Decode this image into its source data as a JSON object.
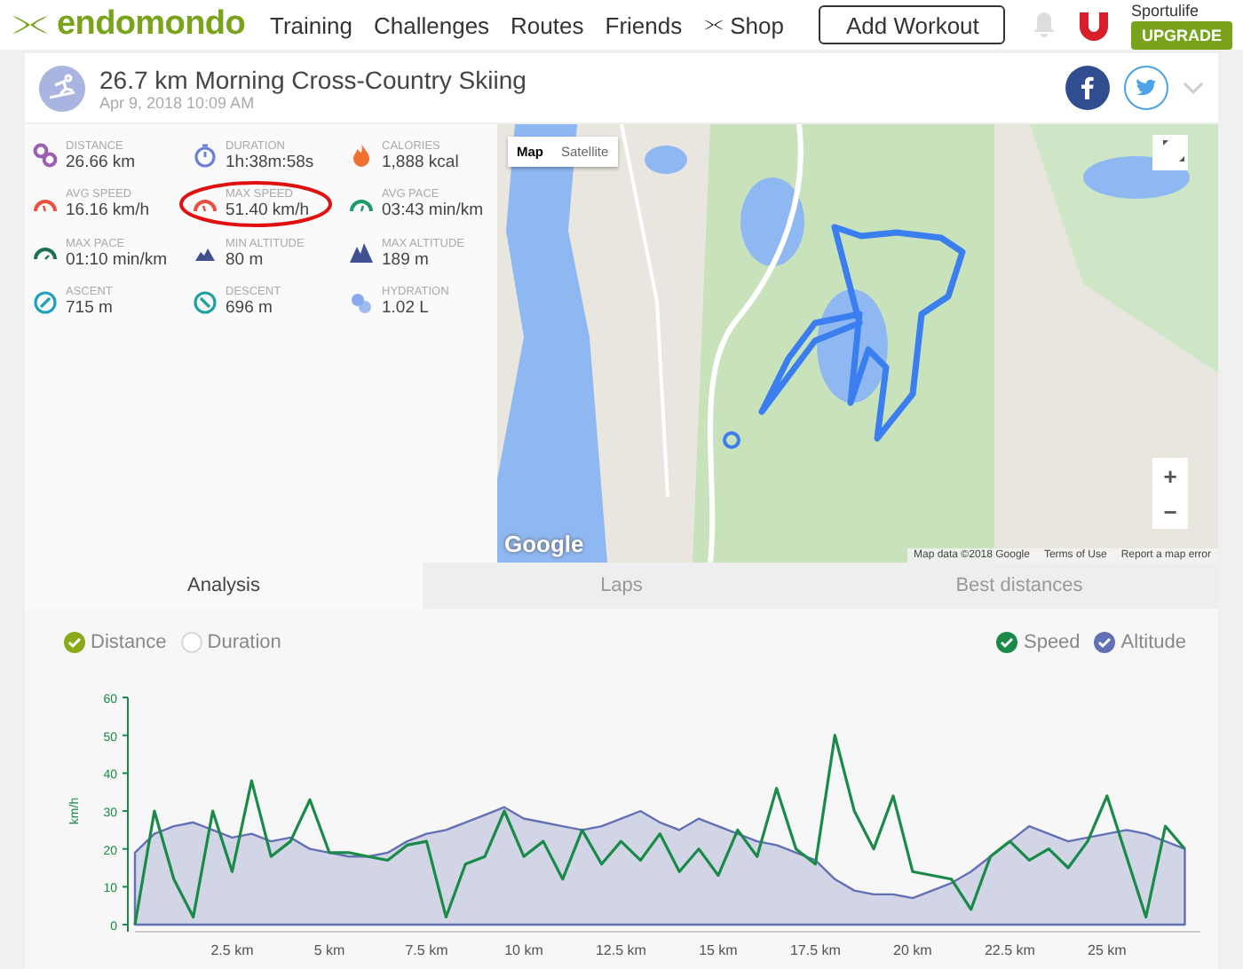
{
  "header": {
    "logo": "endomondo",
    "nav": [
      {
        "label": "Training",
        "kind": "text"
      },
      {
        "label": "Challenges",
        "kind": "text"
      },
      {
        "label": "Routes",
        "kind": "text"
      },
      {
        "label": "Friends",
        "kind": "text"
      },
      {
        "label": "Shop",
        "kind": "brand"
      }
    ],
    "add_button": "Add Workout",
    "user": {
      "name": "Sportulife",
      "upgrade": "UPGRADE"
    }
  },
  "workout": {
    "title": "26.7 km Morning Cross-Country Skiing",
    "date": "Apr 9, 2018 10:09 AM"
  },
  "stats": [
    {
      "label": "DISTANCE",
      "value": "26.66 km",
      "kind": "distance",
      "highlighted": false
    },
    {
      "label": "DURATION",
      "value": "1h:38m:58s",
      "kind": "duration",
      "highlighted": false
    },
    {
      "label": "CALORIES",
      "value": "1,888 kcal",
      "kind": "calories",
      "highlighted": false
    },
    {
      "label": "AVG SPEED",
      "value": "16.16 km/h",
      "kind": "speed",
      "highlighted": false
    },
    {
      "label": "MAX SPEED",
      "value": "51.40 km/h",
      "kind": "speed",
      "highlighted": true
    },
    {
      "label": "AVG PACE",
      "value": "03:43 min/km",
      "kind": "pace",
      "highlighted": false
    },
    {
      "label": "MAX PACE",
      "value": "01:10 min/km",
      "kind": "maxpace",
      "highlighted": false
    },
    {
      "label": "MIN ALTITUDE",
      "value": "80 m",
      "kind": "minalt",
      "highlighted": false
    },
    {
      "label": "MAX ALTITUDE",
      "value": "189 m",
      "kind": "maxalt",
      "highlighted": false
    },
    {
      "label": "ASCENT",
      "value": "715 m",
      "kind": "ascent",
      "highlighted": false
    },
    {
      "label": "DESCENT",
      "value": "696 m",
      "kind": "descent",
      "highlighted": false
    },
    {
      "label": "HYDRATION",
      "value": "1.02 L",
      "kind": "hydration",
      "highlighted": false
    }
  ],
  "map": {
    "types": [
      {
        "label": "Map",
        "selected": true
      },
      {
        "label": "Satellite",
        "selected": false
      }
    ],
    "zoom": [
      "+",
      "−"
    ],
    "logo": "Google",
    "attribution": [
      "Map data ©2018 Google",
      "Terms of Use",
      "Report a map error"
    ]
  },
  "tabs": [
    {
      "label": "Analysis",
      "selected": true
    },
    {
      "label": "Laps",
      "selected": false
    },
    {
      "label": "Best distances",
      "selected": false
    }
  ],
  "x_options": [
    {
      "label": "Distance",
      "checked": true
    },
    {
      "label": "Duration",
      "checked": false
    }
  ],
  "series_options": [
    {
      "checked": true
    },
    {
      "checked": true
    }
  ],
  "chart_data": {
    "type": "line",
    "ylabel": "km/h",
    "ylim": [
      0,
      60
    ],
    "yticks": [
      0,
      10,
      20,
      30,
      40,
      50,
      60
    ],
    "xlim": [
      0,
      27.4
    ],
    "xticks": [
      {
        "value": 2.5,
        "label": "2.5 km"
      },
      {
        "value": 5,
        "label": "5 km"
      },
      {
        "value": 7.5,
        "label": "7.5 km"
      },
      {
        "value": 10,
        "label": "10 km"
      },
      {
        "value": 12.5,
        "label": "12.5 km"
      },
      {
        "value": 15,
        "label": "15 km"
      },
      {
        "value": 17.5,
        "label": "17.5 km"
      },
      {
        "value": 20,
        "label": "20 km"
      },
      {
        "value": 22.5,
        "label": "22.5 km"
      },
      {
        "value": 25,
        "label": "25 km"
      }
    ],
    "x": [
      0,
      0.5,
      1,
      1.5,
      2,
      2.5,
      3,
      3.5,
      4,
      4.5,
      5,
      5.5,
      6,
      6.5,
      7,
      7.5,
      8,
      8.5,
      9,
      9.5,
      10,
      10.5,
      11,
      11.5,
      12,
      12.5,
      13,
      13.5,
      14,
      14.5,
      15,
      15.5,
      16,
      16.5,
      17,
      17.5,
      18,
      18.5,
      19,
      19.5,
      20,
      20.5,
      21,
      21.5,
      22,
      22.5,
      23,
      23.5,
      24,
      24.5,
      25,
      25.5,
      26,
      26.5,
      27
    ],
    "series": [
      {
        "name": "Speed",
        "type": "line",
        "color": "#1a8a48",
        "values": [
          0,
          30,
          12,
          2,
          30,
          14,
          38,
          18,
          22,
          33,
          19,
          19,
          18,
          17,
          21,
          22,
          2,
          16,
          18,
          30,
          18,
          22,
          12,
          25,
          16,
          22,
          17,
          24,
          14,
          20,
          13,
          25,
          18,
          36,
          20,
          16,
          50,
          30,
          20,
          34,
          14,
          13,
          12,
          4,
          18,
          22,
          17,
          20,
          15,
          22,
          34,
          18,
          2,
          26,
          20
        ]
      },
      {
        "name": "Altitude",
        "type": "area",
        "color": "#6470b4",
        "values": [
          19,
          24,
          26,
          27,
          25,
          23,
          24,
          22,
          23,
          20,
          19,
          18,
          18,
          19,
          22,
          24,
          25,
          27,
          29,
          31,
          28,
          27,
          26,
          25,
          26,
          28,
          30,
          27,
          25,
          28,
          26,
          24,
          22,
          21,
          19,
          17,
          12,
          9,
          8,
          8,
          7,
          9,
          11,
          14,
          18,
          22,
          26,
          24,
          22,
          23,
          24,
          25,
          24,
          22,
          20
        ]
      }
    ]
  }
}
